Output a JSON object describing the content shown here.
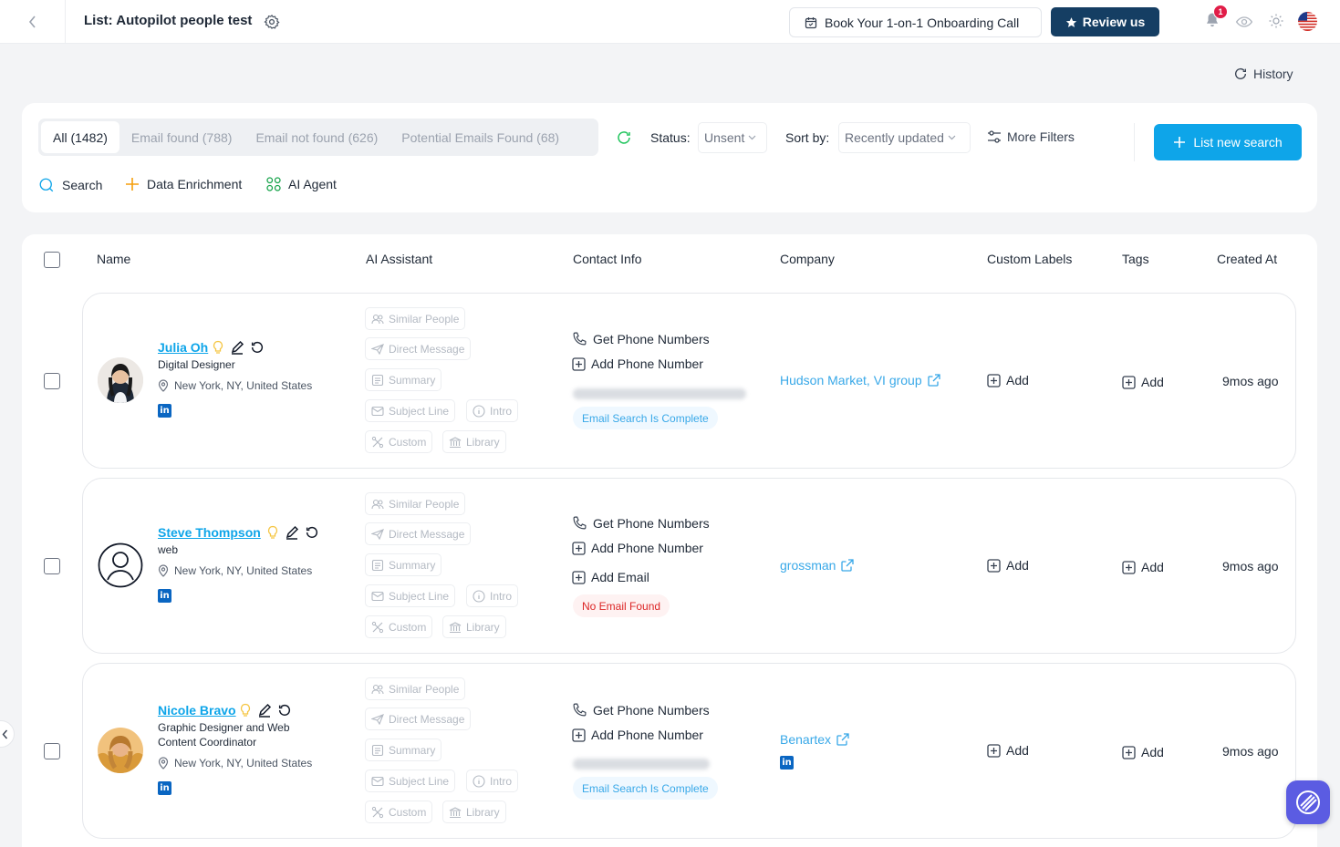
{
  "header": {
    "title": "List: Autopilot people test",
    "book_call_label": "Book Your 1-on-1 Onboarding Call",
    "review_label": "Review us",
    "notification_count": "1"
  },
  "history_label": "History",
  "filters": {
    "tabs": [
      {
        "label": "All (1482)",
        "active": true
      },
      {
        "label": "Email found (788)",
        "active": false
      },
      {
        "label": "Email not found (626)",
        "active": false
      },
      {
        "label": "Potential Emails Found (68)",
        "active": false
      }
    ],
    "status_label": "Status:",
    "status_value": "Unsent",
    "sort_label": "Sort by:",
    "sort_value": "Recently updated",
    "more_filters_label": "More Filters",
    "new_search_label": "List new search",
    "actions": {
      "search": "Search",
      "enrichment": "Data Enrichment",
      "ai_agent": "AI Agent"
    }
  },
  "table": {
    "columns": [
      "Name",
      "AI Assistant",
      "Contact Info",
      "Company",
      "Custom Labels",
      "Tags",
      "Created At"
    ],
    "ai_chips": {
      "similar": "Similar People",
      "direct": "Direct Message",
      "summary": "Summary",
      "subject": "Subject Line",
      "intro": "Intro",
      "custom": "Custom",
      "library": "Library"
    },
    "contact_labels": {
      "get_phone": "Get Phone Numbers",
      "add_phone": "Add Phone Number",
      "add_email": "Add Email"
    },
    "add_label": "Add",
    "rows": [
      {
        "name": "Julia Oh",
        "title": "Digital Designer",
        "location": "New York, NY, United States",
        "email_status": "Email Search Is Complete",
        "company": "Hudson Market, VI group",
        "created": "9mos ago"
      },
      {
        "name": "Steve Thompson",
        "title": "web",
        "location": "New York, NY, United States",
        "email_status": "No Email Found",
        "company": "grossman",
        "created": "9mos ago"
      },
      {
        "name": "Nicole Bravo",
        "title": "Graphic Designer and Web Content Coordinator",
        "location": "New York, NY, United States",
        "email_status": "Email Search Is Complete",
        "company": "Benartex",
        "created": "9mos ago"
      }
    ]
  },
  "colors": {
    "primary": "#0ea5e9",
    "navy": "#153e63",
    "link": "#38a8e8",
    "danger": "#dc2626"
  }
}
